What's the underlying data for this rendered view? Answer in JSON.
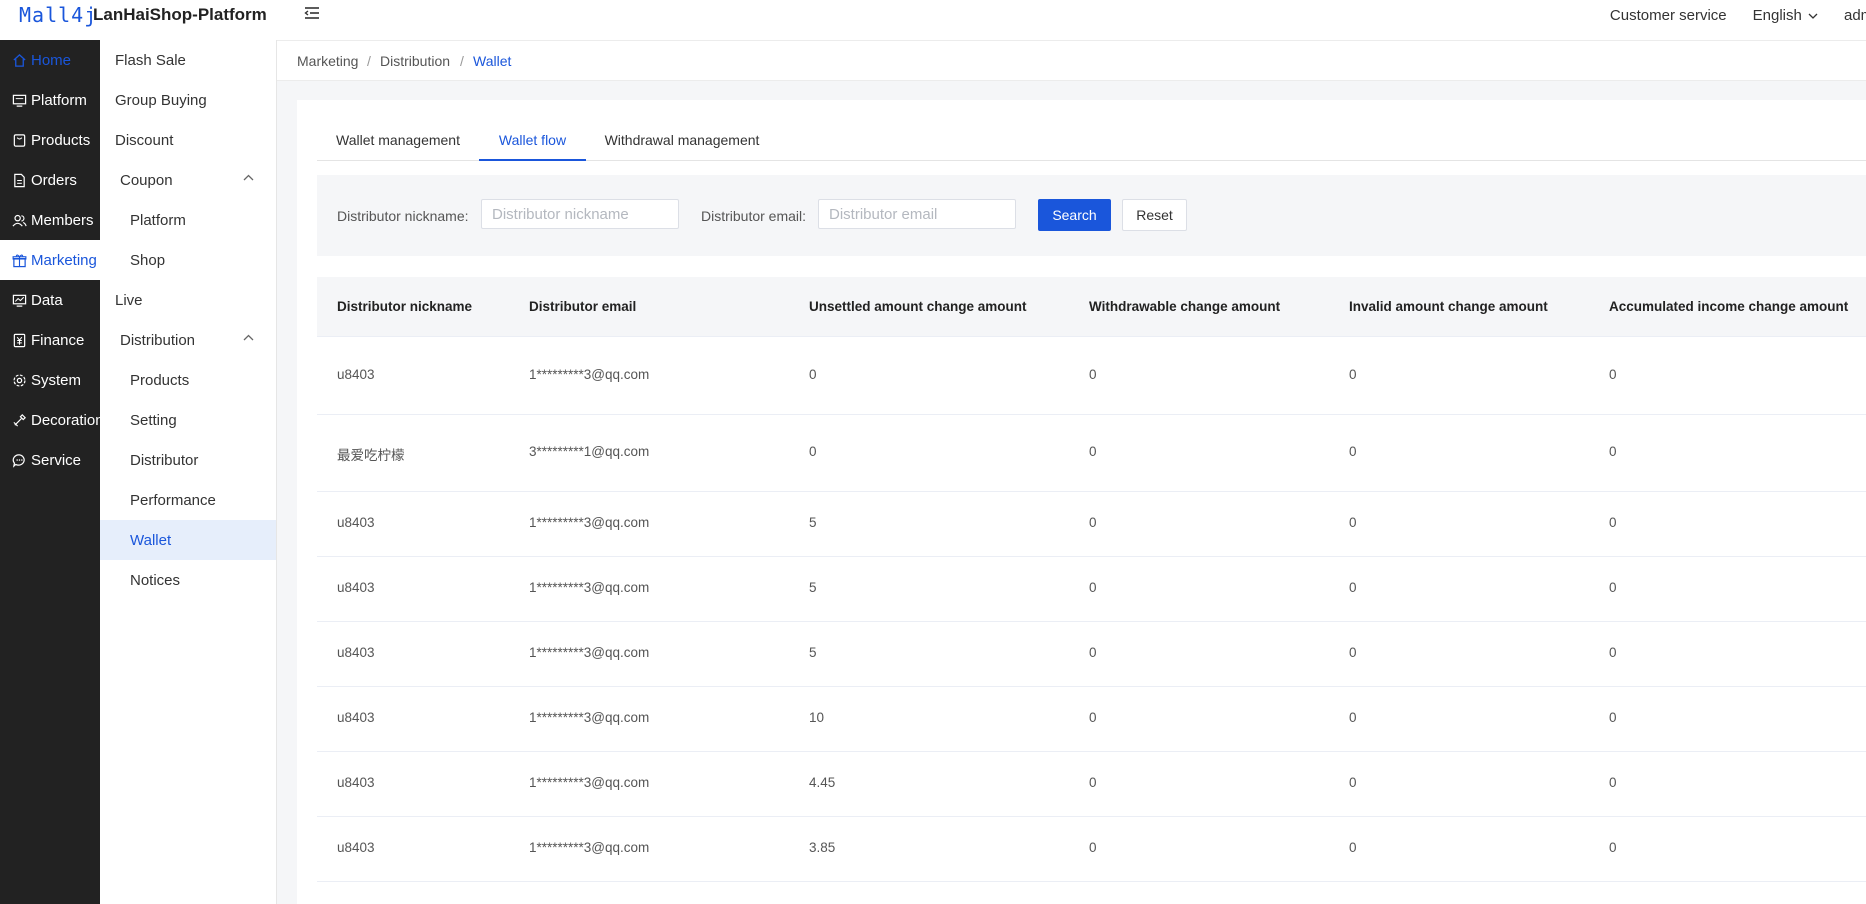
{
  "header": {
    "logo": "Mall4j",
    "title": "LanHaiShop-Platform",
    "customer_service": "Customer service",
    "language": "English",
    "user": "admin"
  },
  "primary_nav": [
    {
      "label": "Home",
      "icon": "home-icon",
      "active": true
    },
    {
      "label": "Platform",
      "icon": "monitor-icon"
    },
    {
      "label": "Products",
      "icon": "bag-icon"
    },
    {
      "label": "Orders",
      "icon": "document-icon"
    },
    {
      "label": "Members",
      "icon": "users-icon"
    },
    {
      "label": "Marketing",
      "icon": "gift-icon",
      "active": true
    },
    {
      "label": "Data",
      "icon": "chart-icon"
    },
    {
      "label": "Finance",
      "icon": "finance-icon"
    },
    {
      "label": "System",
      "icon": "gear-icon"
    },
    {
      "label": "Decoration",
      "icon": "brush-icon"
    },
    {
      "label": "Service",
      "icon": "chat-icon"
    }
  ],
  "secondary_nav": [
    {
      "label": "Flash Sale"
    },
    {
      "label": "Group Buying"
    },
    {
      "label": "Discount"
    },
    {
      "label": "Coupon",
      "expanded": true
    },
    {
      "label": "Platform",
      "child": true
    },
    {
      "label": "Shop",
      "child": true
    },
    {
      "label": "Live"
    },
    {
      "label": "Distribution",
      "expanded": true
    },
    {
      "label": "Products",
      "child": true
    },
    {
      "label": "Setting",
      "child": true
    },
    {
      "label": "Distributor",
      "child": true
    },
    {
      "label": "Performance",
      "child": true
    },
    {
      "label": "Wallet",
      "child": true,
      "active": true
    },
    {
      "label": "Notices",
      "child": true
    }
  ],
  "breadcrumb": [
    "Marketing",
    "Distribution",
    "Wallet"
  ],
  "tabs": [
    {
      "label": "Wallet management"
    },
    {
      "label": "Wallet flow",
      "active": true
    },
    {
      "label": "Withdrawal management"
    }
  ],
  "filters": {
    "nickname_label": "Distributor nickname:",
    "nickname_placeholder": "Distributor nickname",
    "email_label": "Distributor email:",
    "email_placeholder": "Distributor email",
    "search_label": "Search",
    "reset_label": "Reset"
  },
  "table": {
    "columns": [
      "Distributor nickname",
      "Distributor email",
      "Unsettled amount change amount",
      "Withdrawable change amount",
      "Invalid amount change amount",
      "Accumulated income change amount"
    ],
    "rows": [
      [
        "u8403",
        "1*********3@qq.com",
        "0",
        "0",
        "0",
        "0"
      ],
      [
        "最爱吃柠檬",
        "3*********1@qq.com",
        "0",
        "0",
        "0",
        "0"
      ],
      [
        "u8403",
        "1*********3@qq.com",
        "5",
        "0",
        "0",
        "0"
      ],
      [
        "u8403",
        "1*********3@qq.com",
        "5",
        "0",
        "0",
        "0"
      ],
      [
        "u8403",
        "1*********3@qq.com",
        "5",
        "0",
        "0",
        "0"
      ],
      [
        "u8403",
        "1*********3@qq.com",
        "10",
        "0",
        "0",
        "0"
      ],
      [
        "u8403",
        "1*********3@qq.com",
        "4.45",
        "0",
        "0",
        "0"
      ],
      [
        "u8403",
        "1*********3@qq.com",
        "3.85",
        "0",
        "0",
        "0"
      ]
    ]
  },
  "colors": {
    "accent": "#1a56db",
    "sidebar": "#222222",
    "active_bg": "#e6eefb"
  }
}
